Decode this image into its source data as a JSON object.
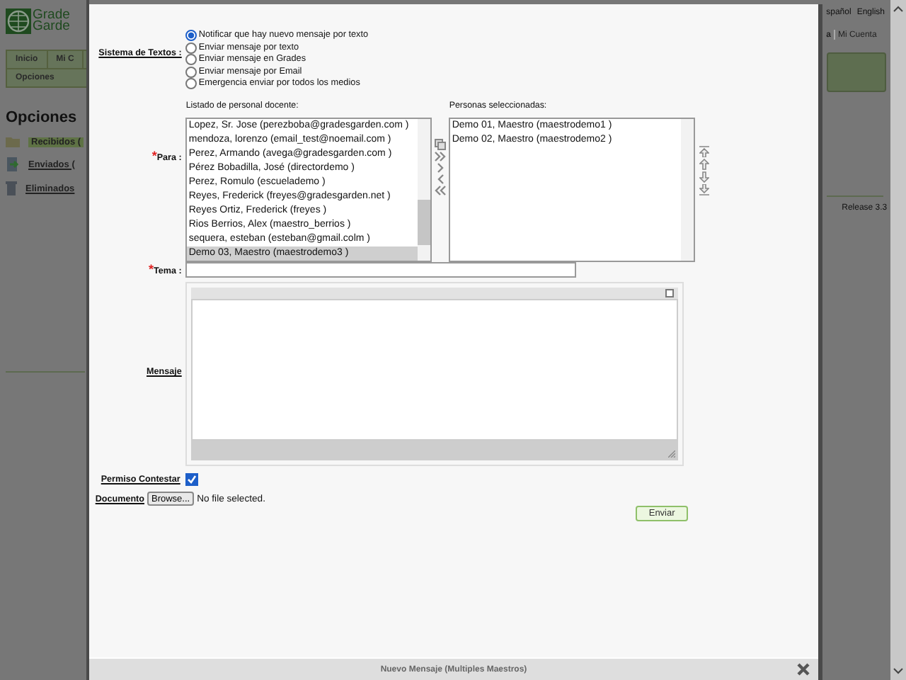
{
  "background": {
    "logo": [
      "Grade",
      "Garde"
    ],
    "nav_tabs": [
      {
        "label": "Inicio"
      },
      {
        "label": "Mi C"
      }
    ],
    "subnav": "Opciones",
    "heading": "Opciones",
    "folders": [
      {
        "label": "Recibidos (",
        "selected": true,
        "kind": "inbox"
      },
      {
        "label": "Enviados (",
        "selected": false,
        "kind": "sent"
      },
      {
        "label": "Eliminados",
        "selected": false,
        "kind": "trash"
      }
    ],
    "languages": [
      "spañol",
      "English"
    ],
    "account_links": [
      "a",
      "Mi Cuenta"
    ],
    "release": "Release 3.3"
  },
  "dialog": {
    "title": "Nuevo Mensaje (Multiples Maestros)",
    "text_system": {
      "label": "Sistema de Textos :",
      "options": [
        {
          "label": "Notificar que hay nuevo mensaje por texto",
          "selected": true
        },
        {
          "label": "Enviar mensaje por texto",
          "selected": false
        },
        {
          "label": "Enviar mensaje en Grades",
          "selected": false
        },
        {
          "label": "Enviar mensaje por Email",
          "selected": false
        },
        {
          "label": "Emergencia enviar por todos los medios",
          "selected": false
        }
      ]
    },
    "staff_list": {
      "label": "Listado de personal docente:",
      "items": [
        {
          "label": "Lopez, Sr. Jose (perezboba@gradesgarden.com )",
          "selected": false
        },
        {
          "label": "mendoza, lorenzo (email_test@noemail.com )",
          "selected": false
        },
        {
          "label": "Perez, Armando (avega@gradesgarden.com )",
          "selected": false
        },
        {
          "label": "Pérez Bobadilla, José (directordemo )",
          "selected": false
        },
        {
          "label": "Perez, Romulo (escuelademo )",
          "selected": false
        },
        {
          "label": "Reyes, Frederick (freyes@gradesgarden.net )",
          "selected": false
        },
        {
          "label": "Reyes Ortiz, Frederick (freyes )",
          "selected": false
        },
        {
          "label": "Rios Berrios, Alex (maestro_berrios )",
          "selected": false
        },
        {
          "label": "sequera, esteban (esteban@gmail.colm )",
          "selected": false
        },
        {
          "label": "Demo 03, Maestro (maestrodemo3 )",
          "selected": true
        }
      ]
    },
    "selected_people": {
      "label": "Personas seleccionadas:",
      "items": [
        {
          "label": "Demo 01, Maestro (maestrodemo1 )",
          "selected": false
        },
        {
          "label": "Demo 02, Maestro (maestrodemo2 )",
          "selected": false
        }
      ]
    },
    "to": {
      "required_mark": "*",
      "label": "Para :"
    },
    "subject": {
      "required_mark": "*",
      "label": "Tema :"
    },
    "message": {
      "label": "Mensaje"
    },
    "reply_permission": {
      "label": "Permiso Contestar",
      "checked": true
    },
    "document": {
      "label": "Documento",
      "button": "Browse...",
      "status": "No file selected."
    },
    "send": "Enviar"
  }
}
